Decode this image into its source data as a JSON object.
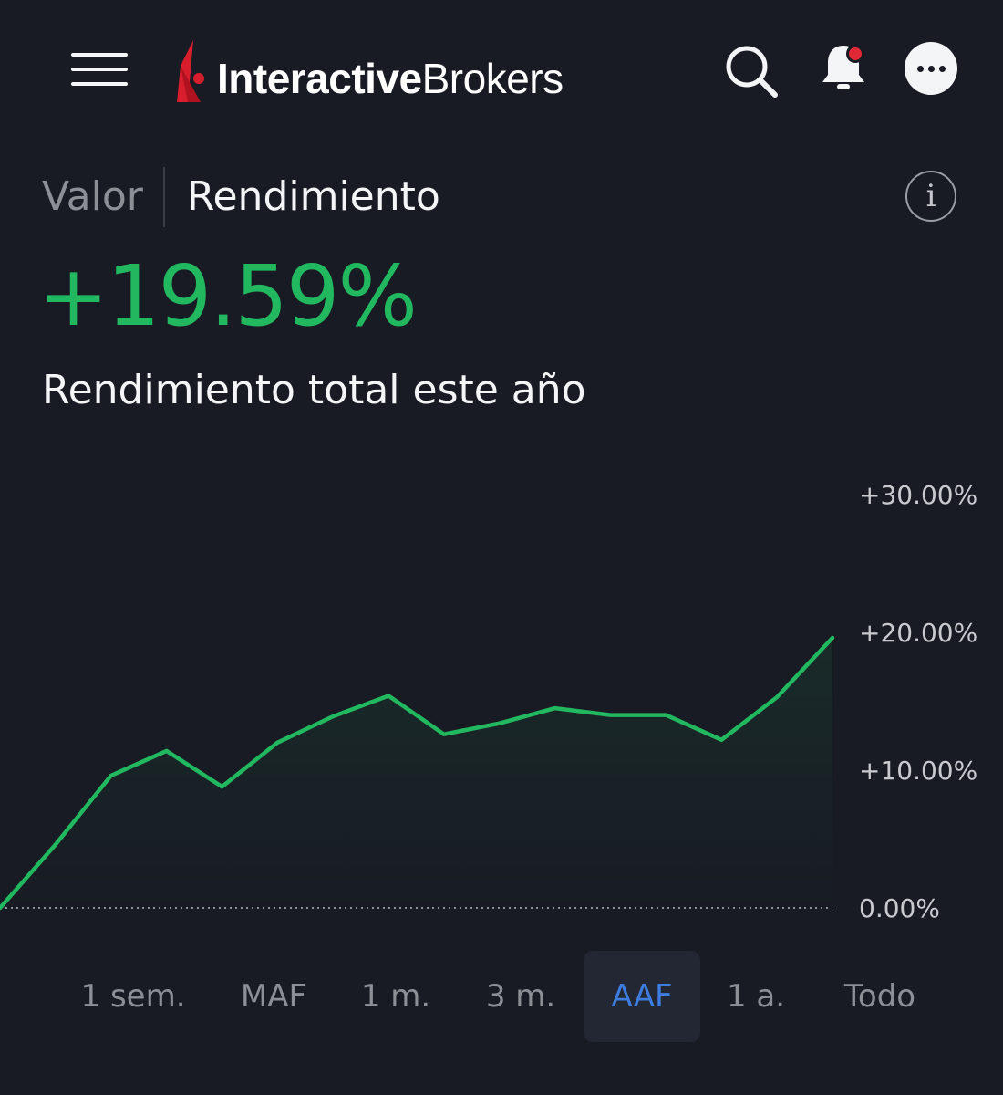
{
  "header": {
    "logo_bold": "Interactive",
    "logo_light": "Brokers",
    "colors": {
      "logo_red": "#d81e2c",
      "notification_dot": "#e02836"
    }
  },
  "tabs": [
    {
      "label": "Valor",
      "active": false
    },
    {
      "label": "Rendimiento",
      "active": true
    }
  ],
  "info_icon": "i",
  "summary": {
    "value": "+19.59%",
    "label": "Rendimiento total este año",
    "color": "#22b85f"
  },
  "chart_data": {
    "type": "area",
    "y_ticks": [
      "+30.00%",
      "+20.00%",
      "+10.00%",
      "0.00%"
    ],
    "ylim": [
      0,
      30
    ],
    "baseline": 0,
    "grid": false,
    "line_color": "#22b85f",
    "series": [
      {
        "values": [
          0.0,
          4.6,
          9.6,
          11.4,
          8.8,
          12.0,
          13.9,
          15.4,
          12.6,
          13.4,
          14.5,
          14.0,
          14.0,
          12.2,
          15.3,
          19.6
        ]
      }
    ]
  },
  "ranges": [
    {
      "label": "1 sem.",
      "selected": false
    },
    {
      "label": "MAF",
      "selected": false
    },
    {
      "label": "1 m.",
      "selected": false
    },
    {
      "label": "3 m.",
      "selected": false
    },
    {
      "label": "AAF",
      "selected": true
    },
    {
      "label": "1 a.",
      "selected": false
    },
    {
      "label": "Todo",
      "selected": false
    }
  ]
}
